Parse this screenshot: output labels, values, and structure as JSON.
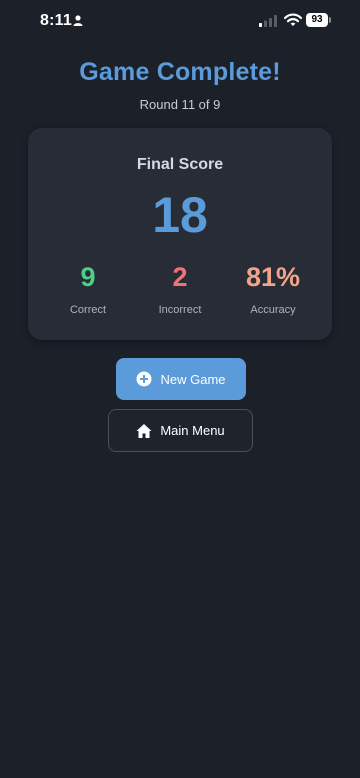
{
  "status_bar": {
    "time": "8:11",
    "battery": "93"
  },
  "header": {
    "title": "Game Complete!",
    "subtitle": "Round 11 of 9"
  },
  "score_card": {
    "heading": "Final Score",
    "score": "18",
    "stats": [
      {
        "value": "9",
        "label": "Correct",
        "color": "#4cd083"
      },
      {
        "value": "2",
        "label": "Incorrect",
        "color": "#f07474"
      },
      {
        "value": "81%",
        "label": "Accuracy",
        "color": "#f2a488"
      }
    ]
  },
  "actions": {
    "new_game": {
      "label": "New Game",
      "icon": "plus-circle-icon"
    },
    "main_menu": {
      "label": "Main Menu",
      "icon": "home-icon"
    }
  },
  "colors": {
    "background": "#1c2029",
    "card": "#272c37",
    "accent": "#5b9bd9"
  }
}
